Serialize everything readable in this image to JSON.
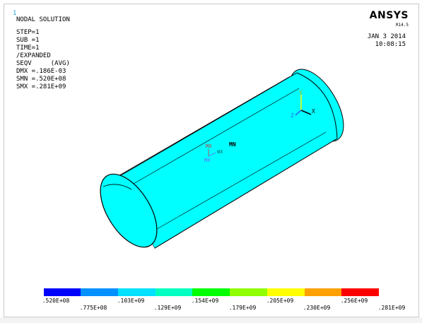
{
  "window": {
    "number": "1",
    "brand": "ANSYS",
    "version": "R14.5",
    "date": "JAN  3 2014",
    "time": "10:08:15"
  },
  "solution_info": {
    "title": "NODAL SOLUTION",
    "lines": [
      "STEP=1",
      "SUB =1",
      "TIME=1",
      "/EXPANDED",
      "SEQV     (AVG)",
      "DMX =.186E-03",
      "SMN =.520E+08",
      "SMX =.281E+09"
    ]
  },
  "model": {
    "fill_color": "#00ffff",
    "triad_labels": {
      "x": "X",
      "y": "Y",
      "z": "Z"
    },
    "marker_labels": {
      "mx": "MX",
      "mx_sub": "MX",
      "mn": "MN",
      "wx": "WX"
    }
  },
  "legend": {
    "colors": [
      "#0000ff",
      "#0090ff",
      "#00e0ff",
      "#00ffc0",
      "#00ff00",
      "#90ff00",
      "#ffff00",
      "#ffa000",
      "#ff0000"
    ],
    "labels_top": [
      ".520E+08",
      ".103E+09",
      ".154E+09",
      ".205E+09",
      ".256E+09"
    ],
    "labels_bottom": [
      ".775E+08",
      ".129E+09",
      ".179E+09",
      ".230E+09",
      ".281E+09"
    ]
  }
}
